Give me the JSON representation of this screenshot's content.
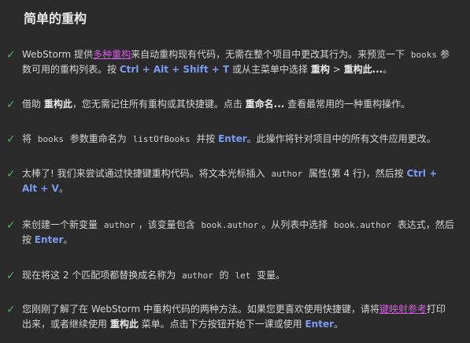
{
  "title": "简单的重构",
  "steps": [
    {
      "parts": [
        {
          "t": "WebStorm 提供"
        },
        {
          "t": "多种重构",
          "cls": "link"
        },
        {
          "t": "来自动重构现有代码，无需在整个项目中更改其行为。来预览一下 "
        },
        {
          "t": "books",
          "cls": "code"
        },
        {
          "t": "参数可用的重构列表。按 "
        },
        {
          "t": "Ctrl + Alt + Shift + T",
          "cls": "kb"
        },
        {
          "t": " 或从主菜单中选择 "
        },
        {
          "t": "重构",
          "cls": "bold"
        },
        {
          "t": " > "
        },
        {
          "t": "重构此...",
          "cls": "bold"
        },
        {
          "t": "。"
        }
      ]
    },
    {
      "parts": [
        {
          "t": "借助 "
        },
        {
          "t": "重构此",
          "cls": "bold"
        },
        {
          "t": "，您无需记住所有重构或其快捷键。点击 "
        },
        {
          "t": "重命名...",
          "cls": "bold"
        },
        {
          "t": " 查看最常用的一种重构操作。"
        }
      ]
    },
    {
      "parts": [
        {
          "t": "将 "
        },
        {
          "t": "books",
          "cls": "code"
        },
        {
          "t": " 参数重命名为 "
        },
        {
          "t": "listOfBooks",
          "cls": "code"
        },
        {
          "t": " 并按 "
        },
        {
          "t": "Enter",
          "cls": "kb"
        },
        {
          "t": "。此操作将针对项目中的所有文件应用更改。"
        }
      ]
    },
    {
      "parts": [
        {
          "t": "太棒了! 我们来尝试通过快捷键重构代码。将文本光标插入 "
        },
        {
          "t": "author",
          "cls": "code"
        },
        {
          "t": " 属性(第 4 行)，然后按 "
        },
        {
          "t": "Ctrl + Alt + V",
          "cls": "kb"
        },
        {
          "t": "。"
        }
      ]
    },
    {
      "parts": [
        {
          "t": "来创建一个新变量 "
        },
        {
          "t": "author",
          "cls": "code"
        },
        {
          "t": "，该变量包含 "
        },
        {
          "t": "book.author",
          "cls": "code"
        },
        {
          "t": "。从列表中选择 "
        },
        {
          "t": "book.author",
          "cls": "code"
        },
        {
          "t": " 表达式，然后按 "
        },
        {
          "t": "Enter",
          "cls": "kb"
        },
        {
          "t": "。"
        }
      ]
    },
    {
      "parts": [
        {
          "t": "现在将这 2 个匹配项都替换成名称为 "
        },
        {
          "t": "author",
          "cls": "code"
        },
        {
          "t": " 的 "
        },
        {
          "t": "let",
          "cls": "code"
        },
        {
          "t": " 变量。"
        }
      ]
    },
    {
      "parts": [
        {
          "t": "您刚刚了解了在 WebStorm 中重构代码的两种方法。如果您更喜欢使用快捷键，请将"
        },
        {
          "t": "键映射参考",
          "cls": "link"
        },
        {
          "t": "打印出来，或者继续使用 "
        },
        {
          "t": "重构此",
          "cls": "bold"
        },
        {
          "t": " 菜单。点击下方按钮开始下一课或使用 "
        },
        {
          "t": "Enter",
          "cls": "kb"
        },
        {
          "t": "。"
        }
      ]
    }
  ]
}
